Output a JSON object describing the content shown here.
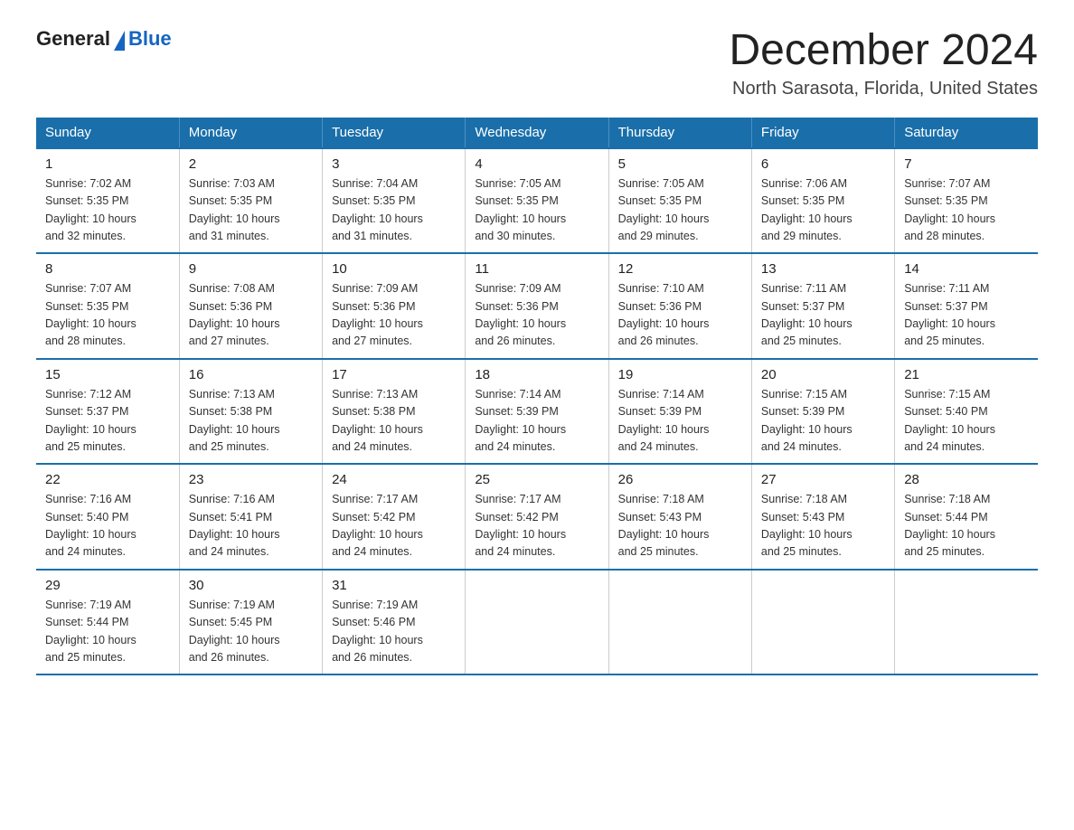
{
  "header": {
    "logo_general": "General",
    "logo_blue": "Blue",
    "title": "December 2024",
    "subtitle": "North Sarasota, Florida, United States"
  },
  "weekdays": [
    "Sunday",
    "Monday",
    "Tuesday",
    "Wednesday",
    "Thursday",
    "Friday",
    "Saturday"
  ],
  "weeks": [
    [
      {
        "day": "1",
        "sunrise": "7:02 AM",
        "sunset": "5:35 PM",
        "daylight": "10 hours and 32 minutes."
      },
      {
        "day": "2",
        "sunrise": "7:03 AM",
        "sunset": "5:35 PM",
        "daylight": "10 hours and 31 minutes."
      },
      {
        "day": "3",
        "sunrise": "7:04 AM",
        "sunset": "5:35 PM",
        "daylight": "10 hours and 31 minutes."
      },
      {
        "day": "4",
        "sunrise": "7:05 AM",
        "sunset": "5:35 PM",
        "daylight": "10 hours and 30 minutes."
      },
      {
        "day": "5",
        "sunrise": "7:05 AM",
        "sunset": "5:35 PM",
        "daylight": "10 hours and 29 minutes."
      },
      {
        "day": "6",
        "sunrise": "7:06 AM",
        "sunset": "5:35 PM",
        "daylight": "10 hours and 29 minutes."
      },
      {
        "day": "7",
        "sunrise": "7:07 AM",
        "sunset": "5:35 PM",
        "daylight": "10 hours and 28 minutes."
      }
    ],
    [
      {
        "day": "8",
        "sunrise": "7:07 AM",
        "sunset": "5:35 PM",
        "daylight": "10 hours and 28 minutes."
      },
      {
        "day": "9",
        "sunrise": "7:08 AM",
        "sunset": "5:36 PM",
        "daylight": "10 hours and 27 minutes."
      },
      {
        "day": "10",
        "sunrise": "7:09 AM",
        "sunset": "5:36 PM",
        "daylight": "10 hours and 27 minutes."
      },
      {
        "day": "11",
        "sunrise": "7:09 AM",
        "sunset": "5:36 PM",
        "daylight": "10 hours and 26 minutes."
      },
      {
        "day": "12",
        "sunrise": "7:10 AM",
        "sunset": "5:36 PM",
        "daylight": "10 hours and 26 minutes."
      },
      {
        "day": "13",
        "sunrise": "7:11 AM",
        "sunset": "5:37 PM",
        "daylight": "10 hours and 25 minutes."
      },
      {
        "day": "14",
        "sunrise": "7:11 AM",
        "sunset": "5:37 PM",
        "daylight": "10 hours and 25 minutes."
      }
    ],
    [
      {
        "day": "15",
        "sunrise": "7:12 AM",
        "sunset": "5:37 PM",
        "daylight": "10 hours and 25 minutes."
      },
      {
        "day": "16",
        "sunrise": "7:13 AM",
        "sunset": "5:38 PM",
        "daylight": "10 hours and 25 minutes."
      },
      {
        "day": "17",
        "sunrise": "7:13 AM",
        "sunset": "5:38 PM",
        "daylight": "10 hours and 24 minutes."
      },
      {
        "day": "18",
        "sunrise": "7:14 AM",
        "sunset": "5:39 PM",
        "daylight": "10 hours and 24 minutes."
      },
      {
        "day": "19",
        "sunrise": "7:14 AM",
        "sunset": "5:39 PM",
        "daylight": "10 hours and 24 minutes."
      },
      {
        "day": "20",
        "sunrise": "7:15 AM",
        "sunset": "5:39 PM",
        "daylight": "10 hours and 24 minutes."
      },
      {
        "day": "21",
        "sunrise": "7:15 AM",
        "sunset": "5:40 PM",
        "daylight": "10 hours and 24 minutes."
      }
    ],
    [
      {
        "day": "22",
        "sunrise": "7:16 AM",
        "sunset": "5:40 PM",
        "daylight": "10 hours and 24 minutes."
      },
      {
        "day": "23",
        "sunrise": "7:16 AM",
        "sunset": "5:41 PM",
        "daylight": "10 hours and 24 minutes."
      },
      {
        "day": "24",
        "sunrise": "7:17 AM",
        "sunset": "5:42 PM",
        "daylight": "10 hours and 24 minutes."
      },
      {
        "day": "25",
        "sunrise": "7:17 AM",
        "sunset": "5:42 PM",
        "daylight": "10 hours and 24 minutes."
      },
      {
        "day": "26",
        "sunrise": "7:18 AM",
        "sunset": "5:43 PM",
        "daylight": "10 hours and 25 minutes."
      },
      {
        "day": "27",
        "sunrise": "7:18 AM",
        "sunset": "5:43 PM",
        "daylight": "10 hours and 25 minutes."
      },
      {
        "day": "28",
        "sunrise": "7:18 AM",
        "sunset": "5:44 PM",
        "daylight": "10 hours and 25 minutes."
      }
    ],
    [
      {
        "day": "29",
        "sunrise": "7:19 AM",
        "sunset": "5:44 PM",
        "daylight": "10 hours and 25 minutes."
      },
      {
        "day": "30",
        "sunrise": "7:19 AM",
        "sunset": "5:45 PM",
        "daylight": "10 hours and 26 minutes."
      },
      {
        "day": "31",
        "sunrise": "7:19 AM",
        "sunset": "5:46 PM",
        "daylight": "10 hours and 26 minutes."
      },
      null,
      null,
      null,
      null
    ]
  ],
  "labels": {
    "sunrise": "Sunrise:",
    "sunset": "Sunset:",
    "daylight": "Daylight:"
  }
}
